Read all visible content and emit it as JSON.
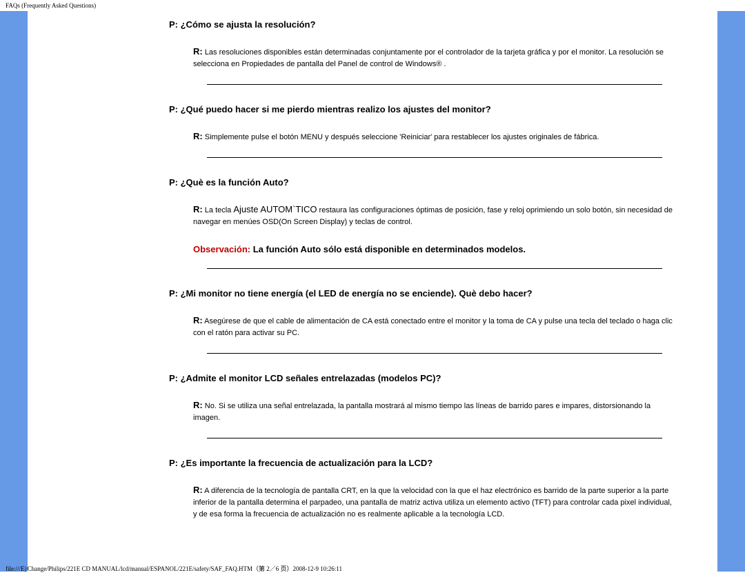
{
  "header": "FAQs (Frequently Asked Questions)",
  "footer": "file:///E|/Change/Philips/221E CD MANUAL/lcd/manual/ESPANOL/221E/safety/SAF_FAQ.HTM（第 2／6 页）2008-12-9 10:26:11",
  "qa": [
    {
      "q": "P: ¿Cómo se ajusta la resolución?",
      "r_prefix": "R:",
      "r": " Las resoluciones disponibles están determinadas conjuntamente por el controlador de la tarjeta gráfica y por el monitor. La resolución se selecciona en Propiedades de pantalla del Panel de control de Windows® ."
    },
    {
      "q": "P: ¿Qué puedo hacer si me pierdo mientras realizo los ajustes del monitor?",
      "r_prefix": "R:",
      "r": " Simplemente pulse el botón MENU y después seleccione 'Reiniciar' para restablecer los ajustes originales de fábrica."
    },
    {
      "q": "P: ¿Què es la función Auto?",
      "r_prefix": "R:",
      "r_before_big": " La tecla ",
      "r_big": "Ajuste AUTOM`TICO",
      "r_after_big": " restaura las configuraciones óptimas de posición, fase y reloj oprimiendo un solo botón, sin necesidad de navegar en menúes OSD(On Screen Display) y teclas de control.",
      "obs_prefix": "Observación:",
      "obs": " La función Auto sólo está disponible en determinados modelos."
    },
    {
      "q": "P: ¿Mi monitor no tiene energía (el LED de energía no se enciende). Què debo hacer?",
      "r_prefix": "R:",
      "r": " Asegúrese de que el cable de alimentación de CA está conectado entre el monitor y la toma de CA y pulse una tecla del teclado o haga clic con el ratón para activar su PC."
    },
    {
      "q": "P: ¿Admite el monitor LCD señales entrelazadas (modelos PC)?",
      "r_prefix": "R:",
      "r": " No. Si se utiliza una señal entrelazada, la pantalla mostrará al mismo tiempo las líneas de barrido pares e impares, distorsionando la imagen."
    },
    {
      "q": "P: ¿Es importante la frecuencia de actualización para la LCD?",
      "r_prefix": "R:",
      "r": " A diferencia de la tecnología de pantalla CRT, en la que la velocidad con la que el haz electrónico es barrido de la parte superior a la parte inferior de la pantalla determina el parpadeo, una pantalla de matriz activa utiliza un elemento activo (TFT) para controlar cada pixel individual, y de esa forma la frecuencia de actualización no es realmente aplicable a la tecnología LCD."
    }
  ]
}
